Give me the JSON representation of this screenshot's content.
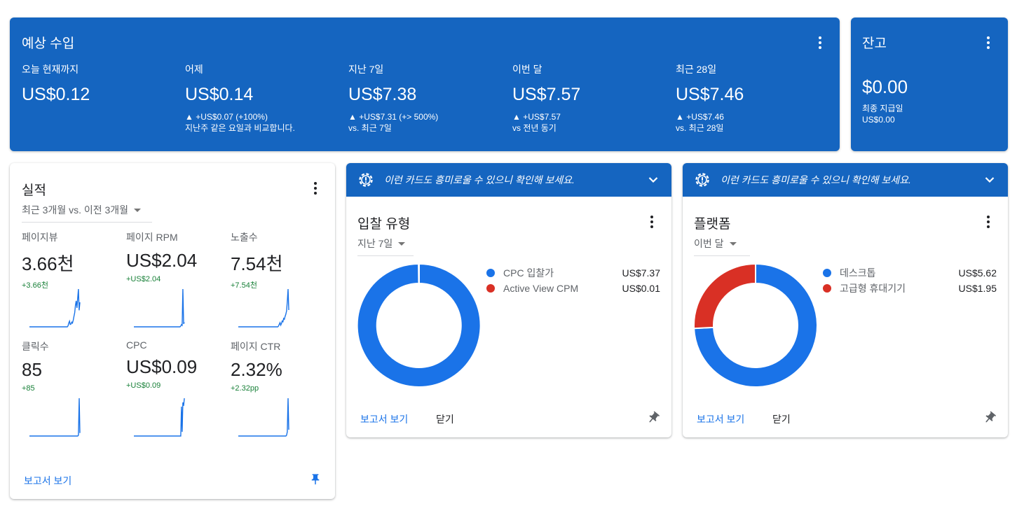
{
  "earnings": {
    "title": "예상 수입",
    "metrics": [
      {
        "label": "오늘 현재까지",
        "value": "US$0.12",
        "change": "",
        "note": ""
      },
      {
        "label": "어제",
        "value": "US$0.14",
        "change": "▲ +US$0.07 (+100%)",
        "note": "지난주 같은 요일과 비교합니다."
      },
      {
        "label": "지난 7일",
        "value": "US$7.38",
        "change": "▲ +US$7.31 (+> 500%)",
        "note": "vs. 최근 7일"
      },
      {
        "label": "이번 달",
        "value": "US$7.57",
        "change": "▲ +US$7.57",
        "note": "vs 전년 동기"
      },
      {
        "label": "최근 28일",
        "value": "US$7.46",
        "change": "▲ +US$7.46",
        "note": "vs. 최근 28일"
      }
    ]
  },
  "balance": {
    "title": "잔고",
    "value": "$0.00",
    "sub_label": "최종 지급일",
    "sub_value": "US$0.00"
  },
  "performance": {
    "title": "실적",
    "period": "최근 3개월 vs. 이전 3개월",
    "metrics": [
      {
        "label": "페이지뷰",
        "value": "3.66천",
        "change": "+3.66천",
        "spark": [
          0,
          0,
          0,
          0,
          0,
          0,
          0,
          0,
          0,
          0,
          0,
          0,
          0,
          0,
          0,
          0,
          0,
          0,
          0,
          0,
          0,
          0,
          0,
          0,
          0,
          0,
          0,
          0,
          0,
          0,
          0,
          0,
          0,
          0,
          0,
          0,
          0,
          0,
          0,
          0,
          0,
          0,
          0,
          0,
          0,
          0,
          0,
          0,
          0,
          0,
          0,
          0,
          2,
          8,
          12,
          5,
          6,
          10,
          8,
          14,
          22,
          30,
          45,
          55,
          40,
          60,
          80,
          35,
          52
        ]
      },
      {
        "label": "페이지 RPM",
        "value": "US$2.04",
        "change": "+US$2.04",
        "spark": [
          0,
          0,
          0,
          0,
          0,
          0,
          0,
          0,
          0,
          0,
          0,
          0,
          0,
          0,
          0,
          0,
          0,
          0,
          0,
          0,
          0,
          0,
          0,
          0,
          0,
          0,
          0,
          0,
          0,
          0,
          0,
          0,
          0,
          0,
          0,
          0,
          0,
          0,
          0,
          0,
          0,
          0,
          0,
          0,
          0,
          0,
          0,
          0,
          0,
          0,
          0,
          0,
          0,
          0,
          0,
          0,
          0,
          0,
          0,
          0,
          0,
          0,
          0,
          0,
          0,
          2,
          6,
          4,
          100,
          8,
          12
        ]
      },
      {
        "label": "노출수",
        "value": "7.54천",
        "change": "+7.54천",
        "spark": [
          0,
          0,
          0,
          0,
          0,
          0,
          0,
          0,
          0,
          0,
          0,
          0,
          0,
          0,
          0,
          0,
          0,
          0,
          0,
          0,
          0,
          0,
          0,
          0,
          0,
          0,
          0,
          0,
          0,
          0,
          0,
          0,
          0,
          0,
          0,
          0,
          0,
          0,
          0,
          0,
          0,
          0,
          0,
          0,
          0,
          0,
          0,
          0,
          0,
          0,
          0,
          0,
          0,
          0,
          0,
          2,
          6,
          10,
          4,
          8,
          14,
          12,
          20,
          18,
          25,
          30,
          38,
          60,
          90,
          40
        ]
      },
      {
        "label": "클릭수",
        "value": "85",
        "change": "+85",
        "spark": [
          0,
          0,
          0,
          0,
          0,
          0,
          0,
          0,
          0,
          0,
          0,
          0,
          0,
          0,
          0,
          0,
          0,
          0,
          0,
          0,
          0,
          0,
          0,
          0,
          0,
          0,
          0,
          0,
          0,
          0,
          0,
          0,
          0,
          0,
          0,
          0,
          0,
          0,
          0,
          0,
          0,
          0,
          0,
          0,
          0,
          0,
          0,
          0,
          0,
          0,
          0,
          0,
          0,
          0,
          0,
          0,
          0,
          0,
          0,
          0,
          0,
          0,
          0,
          0,
          0,
          0,
          0,
          0,
          2,
          100,
          8
        ]
      },
      {
        "label": "CPC",
        "value": "US$0.09",
        "change": "+US$0.09",
        "spark": [
          0,
          0,
          0,
          0,
          0,
          0,
          0,
          0,
          0,
          0,
          0,
          0,
          0,
          0,
          0,
          0,
          0,
          0,
          0,
          0,
          0,
          0,
          0,
          0,
          0,
          0,
          0,
          0,
          0,
          0,
          0,
          0,
          0,
          0,
          0,
          0,
          0,
          0,
          0,
          0,
          0,
          0,
          0,
          0,
          0,
          0,
          0,
          0,
          0,
          0,
          0,
          0,
          0,
          0,
          0,
          0,
          0,
          0,
          0,
          0,
          0,
          0,
          0,
          0,
          0,
          0,
          70,
          10,
          80,
          72,
          90
        ]
      },
      {
        "label": "페이지 CTR",
        "value": "2.32%",
        "change": "+2.32pp",
        "spark": [
          0,
          0,
          0,
          0,
          0,
          0,
          0,
          0,
          0,
          0,
          0,
          0,
          0,
          0,
          0,
          0,
          0,
          0,
          0,
          0,
          0,
          0,
          0,
          0,
          0,
          0,
          0,
          0,
          0,
          0,
          0,
          0,
          0,
          0,
          0,
          0,
          0,
          0,
          0,
          0,
          0,
          0,
          0,
          0,
          0,
          0,
          0,
          0,
          0,
          0,
          0,
          0,
          0,
          0,
          0,
          0,
          0,
          0,
          0,
          0,
          0,
          0,
          0,
          0,
          0,
          0,
          0,
          2,
          10,
          90,
          15
        ]
      }
    ],
    "report_link": "보고서 보기"
  },
  "bid_card": {
    "banner": "이런 카드도 흥미로울 수 있으니 확인해 보세요.",
    "title": "입찰 유형",
    "period": "지난 7일",
    "legend": [
      {
        "name": "CPC 입찰가",
        "amount": "US$7.37",
        "value": 7.37,
        "color": "#1a73e8"
      },
      {
        "name": "Active View CPM",
        "amount": "US$0.01",
        "value": 0.01,
        "color": "#d93025"
      }
    ],
    "report_link": "보고서 보기",
    "close": "닫기"
  },
  "platform_card": {
    "banner": "이런 카드도 흥미로울 수 있으니 확인해 보세요.",
    "title": "플랫폼",
    "period": "이번 달",
    "legend": [
      {
        "name": "데스크톱",
        "amount": "US$5.62",
        "value": 5.62,
        "color": "#1a73e8"
      },
      {
        "name": "고급형 휴대기기",
        "amount": "US$1.95",
        "value": 1.95,
        "color": "#d93025"
      }
    ],
    "report_link": "보고서 보기",
    "close": "닫기"
  }
}
